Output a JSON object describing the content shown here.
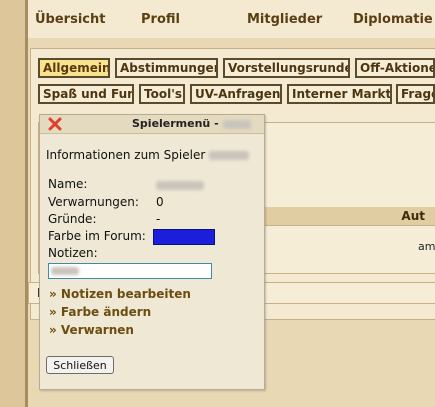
{
  "topnav": {
    "items": [
      "Übersicht",
      "Profil",
      "Mitglieder",
      "Diplomatie"
    ]
  },
  "tabs": {
    "row1": [
      "Allgemein",
      "Abstimmungen",
      "Vorstellungsrunde",
      "Off-Aktione"
    ],
    "row2": [
      "Spaß und Fun",
      "Tool's",
      "UV-Anfragen",
      "Interner Markt",
      "Frage"
    ]
  },
  "table": {
    "header_right": "Aut",
    "cell_text": "am"
  },
  "bottom_bar": {
    "letter": "E"
  },
  "popup": {
    "title": "Spielermenü -",
    "info_title": "Informationen zum Spieler",
    "labels": {
      "name": "Name:",
      "warnings": "Verwarnungen:",
      "reasons": "Gründe:",
      "forum_color": "Farbe im Forum:",
      "notes": "Notizen:"
    },
    "values": {
      "warnings": "0",
      "reasons": "-"
    },
    "forum_color_hex": "#1b1fdc",
    "actions": [
      "» Notizen bearbeiten",
      "» Farbe ändern",
      "» Verwarnen"
    ],
    "close_button": "Schließen"
  },
  "colors": {
    "active_tab": "#f7e48c",
    "link": "#6b4d10",
    "close_icon": "#e0402a"
  },
  "icons": {
    "close": "close-icon"
  }
}
